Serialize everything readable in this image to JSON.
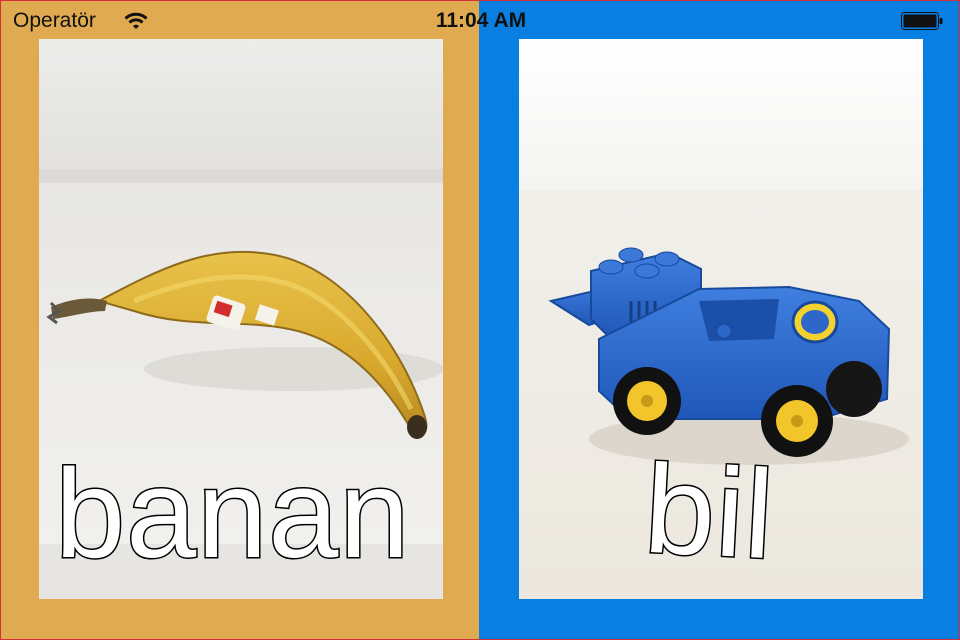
{
  "colors": {
    "left_panel": "#DFAA50",
    "right_panel": "#0A7FE2",
    "outer_border": "#D4303A"
  },
  "statusbar": {
    "carrier": "Operatör",
    "time": "11:04 AM",
    "wifi_icon": "wifi-icon",
    "battery_icon": "battery-full-icon"
  },
  "cards": [
    {
      "word": "banan",
      "image": "banana photo"
    },
    {
      "word": "bil",
      "image": "blue toy race car photo"
    }
  ]
}
